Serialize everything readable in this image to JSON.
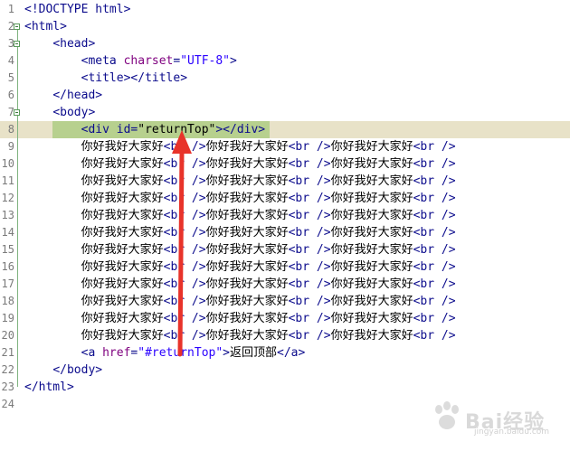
{
  "lines": [
    {
      "n": "1",
      "parts": [
        [
          "tag",
          "<!DOCTYPE html>"
        ]
      ]
    },
    {
      "n": "2",
      "parts": [
        [
          "tag",
          "<html>"
        ]
      ]
    },
    {
      "n": "3",
      "parts": [
        [
          "txt",
          "    "
        ],
        [
          "tag",
          "<head>"
        ]
      ]
    },
    {
      "n": "4",
      "parts": [
        [
          "txt",
          "        "
        ],
        [
          "tag",
          "<meta "
        ],
        [
          "attr",
          "charset"
        ],
        [
          "tag",
          "="
        ],
        [
          "val",
          "\"UTF-8\""
        ],
        [
          "tag",
          ">"
        ]
      ]
    },
    {
      "n": "5",
      "parts": [
        [
          "txt",
          "        "
        ],
        [
          "tag",
          "<title></title>"
        ]
      ]
    },
    {
      "n": "6",
      "parts": [
        [
          "txt",
          "    "
        ],
        [
          "tag",
          "</head>"
        ]
      ]
    },
    {
      "n": "7",
      "parts": [
        [
          "txt",
          "    "
        ],
        [
          "tag",
          "<body>"
        ]
      ]
    },
    {
      "n": "8",
      "parts": [
        [
          "txt",
          "        "
        ],
        [
          "tag",
          "<div id="
        ],
        [
          "txt",
          "\"returnTop\""
        ],
        [
          "tag",
          "></div>"
        ]
      ]
    },
    {
      "n": "9",
      "parts": [
        [
          "txt",
          "        你好我好大家好"
        ],
        [
          "tag",
          "<br />"
        ],
        [
          "txt",
          "你好我好大家好"
        ],
        [
          "tag",
          "<br />"
        ],
        [
          "txt",
          "你好我好大家好"
        ],
        [
          "tag",
          "<br />"
        ]
      ]
    },
    {
      "n": "10",
      "parts": [
        [
          "txt",
          "        你好我好大家好"
        ],
        [
          "tag",
          "<br />"
        ],
        [
          "txt",
          "你好我好大家好"
        ],
        [
          "tag",
          "<br />"
        ],
        [
          "txt",
          "你好我好大家好"
        ],
        [
          "tag",
          "<br />"
        ]
      ]
    },
    {
      "n": "11",
      "parts": [
        [
          "txt",
          "        你好我好大家好"
        ],
        [
          "tag",
          "<br />"
        ],
        [
          "txt",
          "你好我好大家好"
        ],
        [
          "tag",
          "<br />"
        ],
        [
          "txt",
          "你好我好大家好"
        ],
        [
          "tag",
          "<br />"
        ]
      ]
    },
    {
      "n": "12",
      "parts": [
        [
          "txt",
          "        你好我好大家好"
        ],
        [
          "tag",
          "<br />"
        ],
        [
          "txt",
          "你好我好大家好"
        ],
        [
          "tag",
          "<br />"
        ],
        [
          "txt",
          "你好我好大家好"
        ],
        [
          "tag",
          "<br />"
        ]
      ]
    },
    {
      "n": "13",
      "parts": [
        [
          "txt",
          "        你好我好大家好"
        ],
        [
          "tag",
          "<br />"
        ],
        [
          "txt",
          "你好我好大家好"
        ],
        [
          "tag",
          "<br />"
        ],
        [
          "txt",
          "你好我好大家好"
        ],
        [
          "tag",
          "<br />"
        ]
      ]
    },
    {
      "n": "14",
      "parts": [
        [
          "txt",
          "        你好我好大家好"
        ],
        [
          "tag",
          "<br />"
        ],
        [
          "txt",
          "你好我好大家好"
        ],
        [
          "tag",
          "<br />"
        ],
        [
          "txt",
          "你好我好大家好"
        ],
        [
          "tag",
          "<br />"
        ]
      ]
    },
    {
      "n": "15",
      "parts": [
        [
          "txt",
          "        你好我好大家好"
        ],
        [
          "tag",
          "<br />"
        ],
        [
          "txt",
          "你好我好大家好"
        ],
        [
          "tag",
          "<br />"
        ],
        [
          "txt",
          "你好我好大家好"
        ],
        [
          "tag",
          "<br />"
        ]
      ]
    },
    {
      "n": "16",
      "parts": [
        [
          "txt",
          "        你好我好大家好"
        ],
        [
          "tag",
          "<br />"
        ],
        [
          "txt",
          "你好我好大家好"
        ],
        [
          "tag",
          "<br />"
        ],
        [
          "txt",
          "你好我好大家好"
        ],
        [
          "tag",
          "<br />"
        ]
      ]
    },
    {
      "n": "17",
      "parts": [
        [
          "txt",
          "        你好我好大家好"
        ],
        [
          "tag",
          "<br />"
        ],
        [
          "txt",
          "你好我好大家好"
        ],
        [
          "tag",
          "<br />"
        ],
        [
          "txt",
          "你好我好大家好"
        ],
        [
          "tag",
          "<br />"
        ]
      ]
    },
    {
      "n": "18",
      "parts": [
        [
          "txt",
          "        你好我好大家好"
        ],
        [
          "tag",
          "<br />"
        ],
        [
          "txt",
          "你好我好大家好"
        ],
        [
          "tag",
          "<br />"
        ],
        [
          "txt",
          "你好我好大家好"
        ],
        [
          "tag",
          "<br />"
        ]
      ]
    },
    {
      "n": "19",
      "parts": [
        [
          "txt",
          "        你好我好大家好"
        ],
        [
          "tag",
          "<br />"
        ],
        [
          "txt",
          "你好我好大家好"
        ],
        [
          "tag",
          "<br />"
        ],
        [
          "txt",
          "你好我好大家好"
        ],
        [
          "tag",
          "<br />"
        ]
      ]
    },
    {
      "n": "20",
      "parts": [
        [
          "txt",
          "        你好我好大家好"
        ],
        [
          "tag",
          "<br />"
        ],
        [
          "txt",
          "你好我好大家好"
        ],
        [
          "tag",
          "<br />"
        ],
        [
          "txt",
          "你好我好大家好"
        ],
        [
          "tag",
          "<br />"
        ]
      ]
    },
    {
      "n": "21",
      "parts": [
        [
          "txt",
          "        "
        ],
        [
          "tag",
          "<a "
        ],
        [
          "attr",
          "href"
        ],
        [
          "tag",
          "="
        ],
        [
          "val",
          "\"#returnTop\""
        ],
        [
          "tag",
          ">"
        ],
        [
          "txt",
          "返回顶部"
        ],
        [
          "tag",
          "</a>"
        ]
      ]
    },
    {
      "n": "22",
      "parts": [
        [
          "txt",
          "    "
        ],
        [
          "tag",
          "</body>"
        ]
      ]
    },
    {
      "n": "23",
      "parts": [
        [
          "tag",
          "</html>"
        ]
      ]
    },
    {
      "n": "24",
      "parts": []
    }
  ],
  "highlighted_line": "8",
  "fold_markers": [
    "2",
    "3",
    "7"
  ],
  "watermark": {
    "text": "Bai经验",
    "sub": "jingyan.baidu.com"
  },
  "colors": {
    "tag": "#0b0b8c",
    "attribute": "#7f007f",
    "value": "#2a00ff",
    "highlight": "#e8e2c8",
    "selection": "#b7d08e",
    "arrow": "#e8332a"
  },
  "annotation": {
    "icon": "red-arrow-icon"
  }
}
